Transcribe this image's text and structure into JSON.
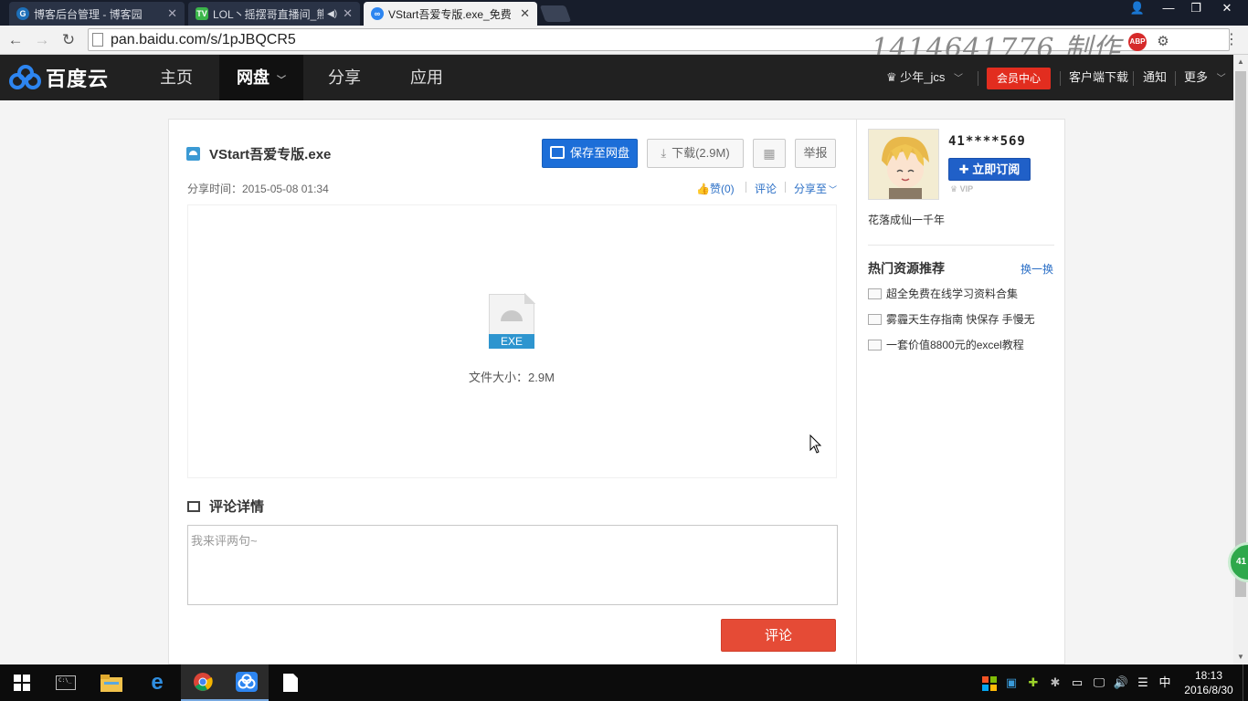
{
  "browser": {
    "tabs": [
      {
        "title": "博客后台管理 - 博客园",
        "icon": "cnblogs-icon"
      },
      {
        "title": "LOL丶摇摆哥直播间_熊",
        "icon": "panda-tv-icon"
      },
      {
        "title": "VStart吾爱专版.exe_免费",
        "icon": "baidu-cloud-icon"
      }
    ],
    "url": "pan.baidu.com/s/1pJBQCR5",
    "watermark": "1414641776 制作",
    "abp_label": "ABP"
  },
  "header": {
    "logo_text": "百度云",
    "nav": [
      "主页",
      "网盘",
      "分享",
      "应用"
    ],
    "user": "少年_jcs",
    "vip_center": "会员中心",
    "client_download": "客户端下载",
    "notify": "通知",
    "more": "更多"
  },
  "file": {
    "name": "VStart吾爱专版.exe",
    "save_button": "保存至网盘",
    "download_button": "下载(2.9M)",
    "report_button": "举报",
    "share_time": "分享时间：2015-05-08 01:34",
    "like": "赞(0)",
    "comment_link": "评论",
    "share_to": "分享至",
    "type_label": "EXE",
    "size_text": "文件大小：2.9M"
  },
  "comments": {
    "title": "评论详情",
    "placeholder": "我来评两句~",
    "submit": "评论"
  },
  "sidebar": {
    "username": "41****569",
    "subscribe": "立即订阅",
    "vip_label": "VIP",
    "description": "花落成仙一千年",
    "hot_title": "热门资源推荐",
    "refresh": "换一换",
    "hot_items": [
      "超全免费在线学习资料合集",
      "雾霾天生存指南 快保存 手慢无",
      "一套价值8800元的excel教程"
    ],
    "float_badge": "41"
  },
  "taskbar": {
    "time": "18:13",
    "date": "2016/8/30",
    "ime": "中"
  }
}
